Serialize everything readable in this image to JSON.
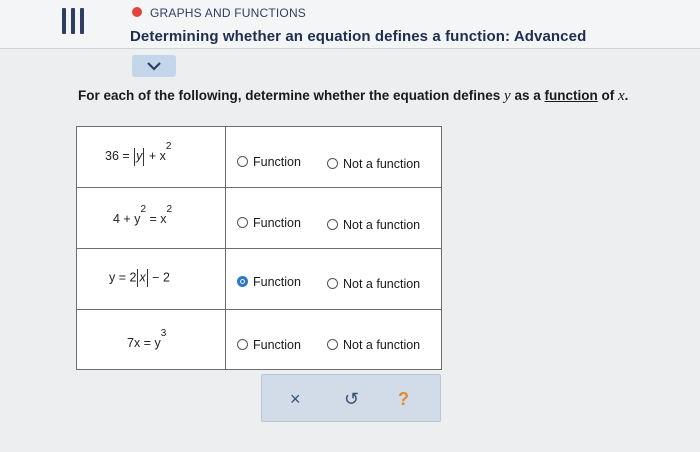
{
  "header": {
    "topic": "GRAPHS AND FUNCTIONS",
    "title": "Determining whether an equation defines a function: Advanced",
    "topic_dot_color": "#e1443a"
  },
  "instruction": {
    "before": "For each of the following, determine whether the equation defines ",
    "var": "y",
    "mid": " as a ",
    "link": "function",
    "after": " of ",
    "var2": "x",
    "end": "."
  },
  "rows": [
    {
      "equation_parts": [
        "36 = ",
        "y",
        " + x",
        "2"
      ],
      "option_function": "Function",
      "option_not": "Not a function",
      "selected": "none"
    },
    {
      "equation_parts": [
        "4 + y",
        "2",
        " = x",
        "2"
      ],
      "option_function": "Function",
      "option_not": "Not a function",
      "selected": "none"
    },
    {
      "equation_parts": [
        "y = 2",
        "x",
        " − 2"
      ],
      "option_function": "Function",
      "option_not": "Not a function",
      "selected": "Function"
    },
    {
      "equation_parts": [
        "7x = y",
        "3"
      ],
      "option_function": "Function",
      "option_not": "Not a function",
      "selected": "none"
    }
  ],
  "actions": {
    "clear": "×",
    "undo": "↺",
    "help": "?"
  },
  "colors": {
    "selected_radio": "#2d79c7",
    "help": "#e18a2a"
  }
}
